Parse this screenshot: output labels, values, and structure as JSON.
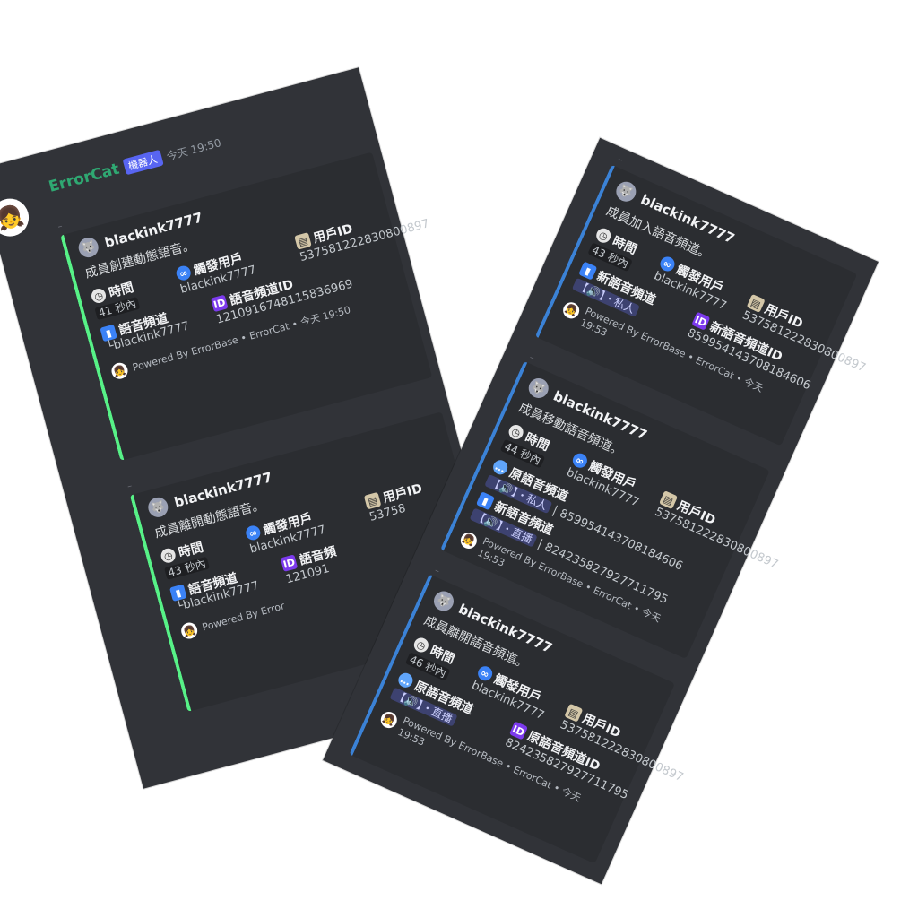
{
  "left_panel": {
    "bot_name": "ErrorCat",
    "bot_badge": "機器人",
    "timestamp": "今天 19:50",
    "bot_avatar_icon": "red-hood-girl-avatar",
    "embeds": [
      {
        "author": "blackink7777",
        "description": "成員創建動態語音。",
        "fields": [
          {
            "icon": "clock-icon",
            "name": "時間",
            "value": "41 秒內"
          },
          {
            "icon": "infinity-icon",
            "name": "觸發用戶",
            "value": "blackink7777"
          },
          {
            "icon": "id-card-icon",
            "name": "用戶ID",
            "value": "537581222830800897"
          },
          {
            "icon": "signal-icon",
            "name": "語音頻道",
            "value": ""
          },
          {
            "icon": "id-badge-icon",
            "name": "語音頻道ID",
            "value": "1210916748115836969"
          }
        ],
        "channel_sub": "└blackink7777",
        "footer": "Powered By ErrorBase • ErrorCat • 今天 19:50"
      },
      {
        "author": "blackink7777",
        "description": "成員離開動態語音。",
        "fields": [
          {
            "icon": "clock-icon",
            "name": "時間",
            "value": "43 秒內"
          },
          {
            "icon": "infinity-icon",
            "name": "觸發用戶",
            "value": "blackink7777"
          },
          {
            "icon": "id-card-icon",
            "name": "用戶ID",
            "value": "53758"
          },
          {
            "icon": "signal-icon",
            "name": "語音頻道",
            "value": ""
          },
          {
            "icon": "id-badge-icon",
            "name": "語音頻",
            "value": "121091"
          }
        ],
        "channel_sub": "└blackink7777",
        "footer": "Powered By Error"
      }
    ]
  },
  "right_panel": {
    "embeds": [
      {
        "author": "blackink7777",
        "description": "成員加入語音頻道。",
        "time_label": "時間",
        "time_value": "43 秒內",
        "trigger_label": "觸發用戶",
        "trigger_value": "blackink7777",
        "uid_label": "用戶ID",
        "uid_value": "537581222830800897",
        "new_channel_label": "新語音頻道",
        "new_channel_chip": "【🔊】・私人",
        "new_channel_id_label": "新語音頻道ID",
        "new_channel_id_value": "859954143708184606",
        "footer": "Powered By ErrorBase • ErrorCat • 今天 19:53"
      },
      {
        "author": "blackink7777",
        "description": "成員移動語音頻道。",
        "time_label": "時間",
        "time_value": "44 秒內",
        "trigger_label": "觸發用戶",
        "trigger_value": "blackink7777",
        "uid_label": "用戶ID",
        "uid_value": "537581222830800897",
        "orig_channel_label": "原語音頻道",
        "orig_channel_chip": "【🔊】・私人",
        "orig_channel_id": "| 859954143708184606",
        "new_channel_label": "新語音頻道",
        "new_channel_chip": "【🔊】・直播",
        "new_channel_id": "| 824235827927711795",
        "footer": "Powered By ErrorBase • ErrorCat • 今天 19:53"
      },
      {
        "author": "blackink7777",
        "description": "成員離開語音頻道。",
        "time_label": "時間",
        "time_value": "46 秒內",
        "trigger_label": "觸發用戶",
        "trigger_value": "blackink7777",
        "uid_label": "用戶ID",
        "uid_value": "537581222830800897",
        "orig_channel_label": "原語音頻道",
        "orig_channel_chip": "【🔊】・直播",
        "orig_channel_id_label": "原語音頻道ID",
        "orig_channel_id_value": "824235827927711795",
        "footer": "Powered By ErrorBase • ErrorCat • 今天 19:53"
      }
    ]
  },
  "colors": {
    "panel_bg": "#313338",
    "embed_bg": "#2b2d31",
    "green_accent": "#57f287",
    "blue_accent": "#3b82d6",
    "username_green": "#2fa872",
    "badge_blurple": "#5865f2"
  }
}
